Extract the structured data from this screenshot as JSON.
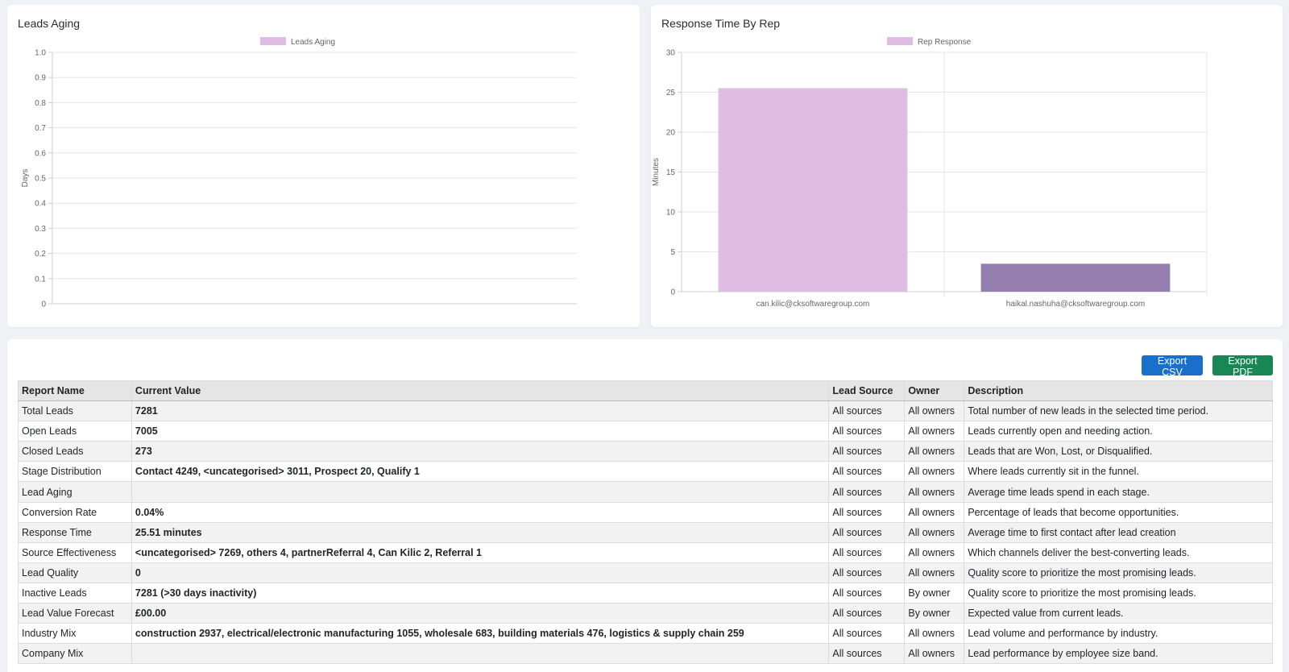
{
  "charts": [
    {
      "id": "leads-aging",
      "type": "bar",
      "title": "Leads Aging",
      "legend": [
        {
          "label": "Leads Aging",
          "color": "#e0bbe4"
        }
      ],
      "legend_position": "top",
      "ylabel": "Days",
      "ylim": [
        0,
        1.0
      ],
      "yticks": [
        "1.0",
        "0.9",
        "0.8",
        "0.7",
        "0.6",
        "0.5",
        "0.4",
        "0.3",
        "0.2",
        "0.1",
        "0"
      ],
      "categories": [],
      "values": []
    },
    {
      "id": "response-time",
      "type": "bar",
      "title": "Response Time By Rep",
      "legend": [
        {
          "label": "Rep Response",
          "color": "#e0bbe4"
        }
      ],
      "legend_position": "top",
      "ylabel": "Minutes",
      "ylim": [
        0,
        30
      ],
      "yticks": [
        "30",
        "25",
        "20",
        "15",
        "10",
        "5",
        "0"
      ],
      "categories": [
        "can.kilic@cksoftwaregroup.com",
        "haikal.nashuha@cksoftwaregroup.com"
      ],
      "values": [
        25.51,
        3.5
      ],
      "bar_colors": [
        "#e0bbe4",
        "#957dad"
      ]
    }
  ],
  "chart_data": [
    {
      "type": "bar",
      "title": "Leads Aging",
      "ylabel": "Days",
      "ylim": [
        0,
        1.0
      ],
      "series": [
        {
          "name": "Leads Aging",
          "values": []
        }
      ],
      "categories": []
    },
    {
      "type": "bar",
      "title": "Response Time By Rep",
      "ylabel": "Minutes",
      "ylim": [
        0,
        30
      ],
      "categories": [
        "can.kilic@cksoftwaregroup.com",
        "haikal.nashuha@cksoftwaregroup.com"
      ],
      "series": [
        {
          "name": "Rep Response",
          "values": [
            25.51,
            3.5
          ]
        }
      ]
    }
  ],
  "toolbar": {
    "export_csv_label": "Export CSV",
    "export_pdf_label": "Export PDF",
    "csv_color": "#1a6fcb",
    "pdf_color": "#198754"
  },
  "table": {
    "headers": [
      "Report Name",
      "Current Value",
      "Lead Source",
      "Owner",
      "Description"
    ],
    "rows": [
      [
        "Total Leads",
        "7281",
        "All sources",
        "All owners",
        "Total number of new leads in the selected time period."
      ],
      [
        "Open Leads",
        "7005",
        "All sources",
        "All owners",
        "Leads currently open and needing action."
      ],
      [
        "Closed Leads",
        "273",
        "All sources",
        "All owners",
        "Leads that are Won, Lost, or Disqualified."
      ],
      [
        "Stage Distribution",
        "Contact 4249, <uncategorised> 3011, Prospect 20, Qualify 1",
        "All sources",
        "All owners",
        "Where leads currently sit in the funnel."
      ],
      [
        "Lead Aging",
        "",
        "All sources",
        "All owners",
        "Average time leads spend in each stage."
      ],
      [
        "Conversion Rate",
        "0.04%",
        "All sources",
        "All owners",
        "Percentage of leads that become opportunities."
      ],
      [
        "Response Time",
        "25.51 minutes",
        "All sources",
        "All owners",
        "Average time to first contact after lead creation"
      ],
      [
        "Source Effectiveness",
        "<uncategorised> 7269, others 4, partnerReferral 4, Can Kilic 2, Referral 1",
        "All sources",
        "All owners",
        "Which channels deliver the best-converting leads."
      ],
      [
        "Lead Quality",
        "0",
        "All sources",
        "All owners",
        "Quality score to prioritize the most promising leads."
      ],
      [
        "Inactive Leads",
        "7281 (>30 days inactivity)",
        "All sources",
        "By owner",
        "Quality score to prioritize the most promising leads."
      ],
      [
        "Lead Value Forecast",
        "£00.00",
        "All sources",
        "By owner",
        "Expected value from current leads."
      ],
      [
        "Industry Mix",
        "construction 2937, electrical/electronic manufacturing 1055, wholesale 683, building materials 476, logistics & supply chain 259",
        "All sources",
        "All owners",
        "Lead volume and performance by industry."
      ],
      [
        "Company Mix",
        "",
        "All sources",
        "All owners",
        "Lead performance by employee size band."
      ]
    ]
  }
}
